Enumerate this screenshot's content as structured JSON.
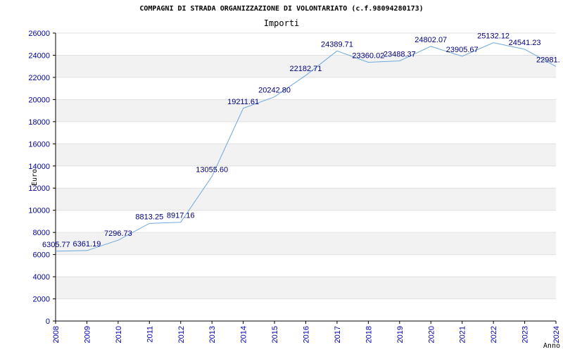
{
  "chart_data": {
    "type": "line",
    "title": "COMPAGNI DI STRADA ORGANIZZAZIONE DI VOLONTARIATO (c.f.98094280173)",
    "subtitle": "Importi",
    "ylabel": "Euro",
    "xlabel": "Anno",
    "ylim": [
      0,
      26000
    ],
    "yticks": [
      "0",
      "2000",
      "4000",
      "6000",
      "8000",
      "10000",
      "12000",
      "14000",
      "16000",
      "18000",
      "20000",
      "22000",
      "24000",
      "26000"
    ],
    "ytick_values": [
      0,
      2000,
      4000,
      6000,
      8000,
      10000,
      12000,
      14000,
      16000,
      18000,
      20000,
      22000,
      24000,
      26000
    ],
    "categories": [
      "2008",
      "2009",
      "2010",
      "2011",
      "2012",
      "2013",
      "2014",
      "2015",
      "2016",
      "2017",
      "2018",
      "2019",
      "2020",
      "2021",
      "2022",
      "2023",
      "2024"
    ],
    "values": [
      6305.77,
      6361.19,
      7296.73,
      8813.25,
      8917.16,
      13055.6,
      19211.61,
      20242.8,
      22182.71,
      24389.71,
      23360.02,
      23488.37,
      24802.07,
      23905.67,
      25132.12,
      24541.23,
      22981.1
    ],
    "value_labels": [
      "6305.77",
      "6361.19",
      "7296.73",
      "8813.25",
      "8917.16",
      "13055.60",
      "19211.61",
      "20242.80",
      "22182.71",
      "24389.71",
      "23360.02",
      "23488.37",
      "24802.07",
      "23905.67",
      "25132.12",
      "24541.23",
      "22981."
    ],
    "grid": true,
    "band_color": "#f2f2f2",
    "line_color": "#6fa8dc",
    "axis_text_color": "#0000aa",
    "label_color": "#000080",
    "gridline_color": "#e0e0e0",
    "axis_line_color": "#000000"
  }
}
